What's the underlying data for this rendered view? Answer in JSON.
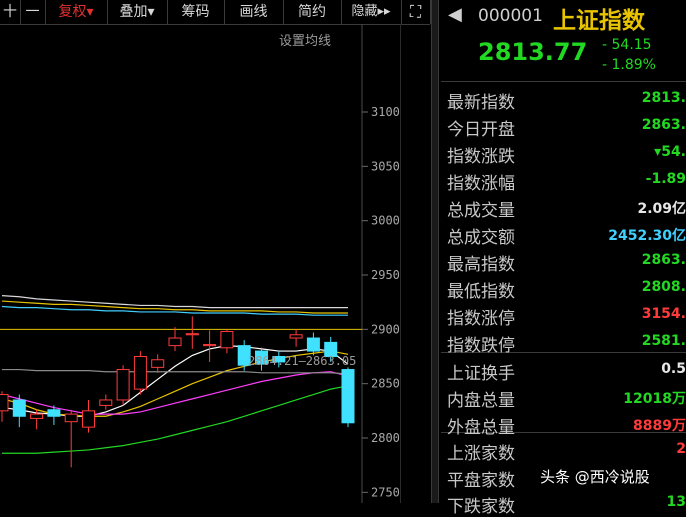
{
  "toolbar": {
    "items": [
      "十",
      "一",
      "复权▾",
      "叠加▾",
      "筹码",
      "画线",
      "简约",
      "隐藏▸▸",
      "⛶"
    ]
  },
  "chart": {
    "setting_label": "设置均线",
    "floating_label": "2864.21–2863.05"
  },
  "chart_data": {
    "type": "candlestick",
    "y_ticks": [
      "3100.00",
      "3050.00",
      "3000.00",
      "2950.00",
      "2900.00",
      "2850.00",
      "2800.00",
      "2750.00"
    ],
    "ylim": [
      2750,
      3100
    ],
    "candles": [
      {
        "o": 2825,
        "c": 2840,
        "h": 2843,
        "l": 2815
      },
      {
        "o": 2835,
        "c": 2820,
        "h": 2840,
        "l": 2810
      },
      {
        "o": 2818,
        "c": 2822,
        "h": 2826,
        "l": 2808
      },
      {
        "o": 2826,
        "c": 2820,
        "h": 2830,
        "l": 2812
      },
      {
        "o": 2815,
        "c": 2822,
        "h": 2826,
        "l": 2773
      },
      {
        "o": 2810,
        "c": 2825,
        "h": 2835,
        "l": 2805
      },
      {
        "o": 2830,
        "c": 2835,
        "h": 2840,
        "l": 2826
      },
      {
        "o": 2835,
        "c": 2863,
        "h": 2867,
        "l": 2830
      },
      {
        "o": 2845,
        "c": 2875,
        "h": 2880,
        "l": 2840
      },
      {
        "o": 2865,
        "c": 2872,
        "h": 2877,
        "l": 2860
      },
      {
        "o": 2885,
        "c": 2892,
        "h": 2902,
        "l": 2880
      },
      {
        "o": 2895,
        "c": 2896,
        "h": 2912,
        "l": 2882
      },
      {
        "o": 2885,
        "c": 2886,
        "h": 2899,
        "l": 2870
      },
      {
        "o": 2883,
        "c": 2898,
        "h": 2900,
        "l": 2878
      },
      {
        "o": 2885,
        "c": 2867,
        "h": 2890,
        "l": 2862
      },
      {
        "o": 2880,
        "c": 2868,
        "h": 2883,
        "l": 2862
      },
      {
        "o": 2875,
        "c": 2870,
        "h": 2880,
        "l": 2865
      },
      {
        "o": 2892,
        "c": 2895,
        "h": 2900,
        "l": 2884
      },
      {
        "o": 2892,
        "c": 2880,
        "h": 2897,
        "l": 2876
      },
      {
        "o": 2888,
        "c": 2875,
        "h": 2893,
        "l": 2870
      },
      {
        "o": 2863,
        "c": 2814,
        "h": 2865,
        "l": 2810
      }
    ],
    "series": [
      {
        "color": "#ffffff",
        "values": [
          2828,
          2826,
          2823,
          2822,
          2820,
          2820,
          2824,
          2830,
          2842,
          2854,
          2866,
          2876,
          2882,
          2885,
          2884,
          2882,
          2880,
          2880,
          2882,
          2880,
          2868
        ]
      },
      {
        "color": "#e8c400",
        "values": [
          2836,
          2832,
          2826,
          2822,
          2821,
          2820,
          2820,
          2824,
          2829,
          2836,
          2843,
          2850,
          2856,
          2862,
          2866,
          2870,
          2873,
          2876,
          2878,
          2880,
          2877
        ]
      },
      {
        "color": "#ff40ff",
        "values": [
          2840,
          2836,
          2832,
          2828,
          2825,
          2822,
          2822,
          2822,
          2824,
          2828,
          2832,
          2836,
          2840,
          2844,
          2848,
          2852,
          2855,
          2858,
          2860,
          2861,
          2857
        ]
      },
      {
        "color": "#22d822",
        "values": [
          2786,
          2786,
          2786,
          2787,
          2788,
          2789,
          2791,
          2793,
          2796,
          2799,
          2803,
          2807,
          2811,
          2815,
          2820,
          2825,
          2830,
          2835,
          2840,
          2845,
          2848
        ]
      },
      {
        "color": "#8a8a8a",
        "values": [
          2863,
          2863,
          2862,
          2862,
          2862,
          2862,
          2861,
          2861,
          2861,
          2861,
          2861,
          2861,
          2861,
          2861,
          2861,
          2860,
          2860,
          2860,
          2860,
          2860,
          2859
        ]
      },
      {
        "color": "#d8d8d8",
        "values": [
          2931,
          2930,
          2928,
          2927,
          2926,
          2925,
          2924,
          2923,
          2922,
          2922,
          2921,
          2921,
          2920,
          2920,
          2920,
          2920,
          2920,
          2920,
          2920,
          2920,
          2920
        ]
      },
      {
        "color": "#e8c400",
        "values": [
          2926,
          2925,
          2924,
          2923,
          2923,
          2922,
          2921,
          2920,
          2919,
          2919,
          2918,
          2918,
          2917,
          2917,
          2917,
          2917,
          2916,
          2916,
          2915,
          2915,
          2915
        ]
      },
      {
        "color": "#40d0ff",
        "values": [
          2921,
          2920,
          2920,
          2919,
          2918,
          2918,
          2917,
          2917,
          2916,
          2916,
          2916,
          2915,
          2915,
          2915,
          2915,
          2914,
          2914,
          2914,
          2913,
          2913,
          2913
        ]
      }
    ],
    "ref_line": 2900
  },
  "quote": {
    "code": "000001",
    "name": "上证指数",
    "price": "2813.77",
    "change": "- 54.15",
    "change_pct": "- 1.89%",
    "rows": [
      {
        "label": "最新指数",
        "value": "2813.",
        "cls": "g"
      },
      {
        "label": "今日开盘",
        "value": "2863.",
        "cls": "g"
      },
      {
        "label": "指数涨跌",
        "value": "▾54.",
        "cls": "g"
      },
      {
        "label": "指数涨幅",
        "value": "-1.89",
        "cls": "g"
      },
      {
        "label": "总成交量",
        "value": "2.09亿",
        "cls": "w"
      },
      {
        "label": "总成交额",
        "value": "2452.30亿",
        "cls": "c"
      },
      {
        "label": "最高指数",
        "value": "2863.",
        "cls": "g"
      },
      {
        "label": "最低指数",
        "value": "2808.",
        "cls": "g"
      },
      {
        "label": "指数涨停",
        "value": "3154.",
        "cls": "r"
      },
      {
        "label": "指数跌停",
        "value": "2581.",
        "cls": "g"
      },
      {
        "label": "上证换手",
        "value": "0.5",
        "cls": "w"
      },
      {
        "label": "内盘总量",
        "value": "12018万",
        "cls": "g"
      },
      {
        "label": "外盘总量",
        "value": "8889万",
        "cls": "r"
      },
      {
        "label": "上涨家数",
        "value": "2",
        "cls": "r"
      },
      {
        "label": "平盘家数",
        "value": "",
        "cls": "w"
      },
      {
        "label": "下跌家数",
        "value": "13",
        "cls": "g"
      }
    ]
  },
  "watermark": "头条 @西冷说股"
}
